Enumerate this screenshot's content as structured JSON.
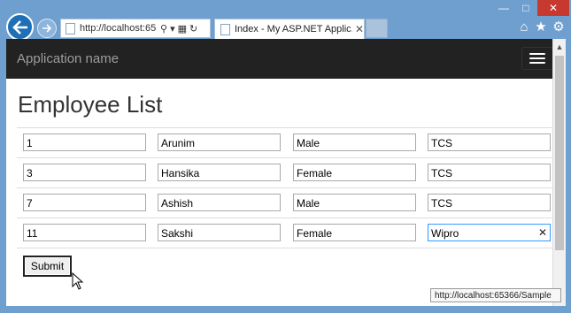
{
  "browser": {
    "address_url": "http://localhost:65",
    "tab_title": "Index - My ASP.NET Applic...",
    "status_url": "http://localhost:65366/Sample",
    "icons": [
      "back-arrow-icon",
      "forward-arrow-icon",
      "search-icon",
      "refresh-icon",
      "home-icon",
      "star-icon",
      "gear-icon"
    ]
  },
  "navbar": {
    "brand": "Application name"
  },
  "page": {
    "title": "Employee List",
    "rows": [
      {
        "id": "1",
        "name": "Arunim",
        "gender": "Male",
        "company": "TCS"
      },
      {
        "id": "3",
        "name": "Hansika",
        "gender": "Female",
        "company": "TCS"
      },
      {
        "id": "7",
        "name": "Ashish",
        "gender": "Male",
        "company": "TCS"
      },
      {
        "id": "11",
        "name": "Sakshi",
        "gender": "Female",
        "company": "Wipro"
      }
    ],
    "submit_label": "Submit"
  },
  "colors": {
    "frame": "#6f9fcf",
    "navbar": "#222222",
    "close_button": "#c7382f"
  }
}
